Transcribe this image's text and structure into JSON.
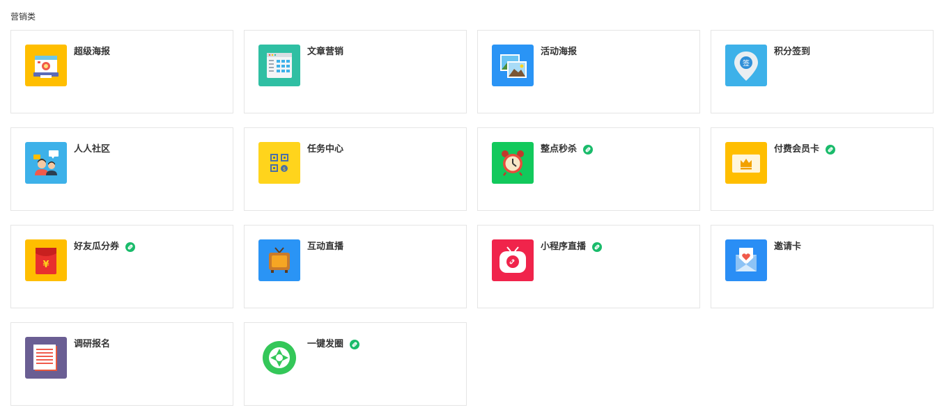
{
  "section": {
    "title": "营销类"
  },
  "cards": [
    {
      "title": "超级海报",
      "icon": "poster-camera-icon",
      "bg": "#FFBE00",
      "mini_program": false
    },
    {
      "title": "文章营销",
      "icon": "article-webpage-icon",
      "bg": "#2FBFA3",
      "mini_program": false
    },
    {
      "title": "活动海报",
      "icon": "picture-frames-icon",
      "bg": "#2A94F5",
      "mini_program": false
    },
    {
      "title": "积分签到",
      "icon": "sign-in-pin-icon",
      "bg": "#3DB1E9",
      "mini_program": false
    },
    {
      "title": "人人社区",
      "icon": "community-people-icon",
      "bg": "#3DB1E9",
      "mini_program": false
    },
    {
      "title": "任务中心",
      "icon": "task-qrcode-icon",
      "bg": "#FFD41C",
      "mini_program": false
    },
    {
      "title": "整点秒杀",
      "icon": "alarm-clock-icon",
      "bg": "#12C95C",
      "mini_program": true
    },
    {
      "title": "付费会员卡",
      "icon": "crown-card-icon",
      "bg": "#FFBE00",
      "mini_program": true
    },
    {
      "title": "好友瓜分券",
      "icon": "red-envelope-icon",
      "bg": "#FFBE00",
      "mini_program": true
    },
    {
      "title": "互动直播",
      "icon": "retro-tv-icon",
      "bg": "#2A94F5",
      "mini_program": false
    },
    {
      "title": "小程序直播",
      "icon": "live-tv-icon",
      "bg": "#F0244B",
      "mini_program": true
    },
    {
      "title": "邀请卡",
      "icon": "heart-envelope-icon",
      "bg": "#2A8EF5",
      "mini_program": false
    },
    {
      "title": "调研报名",
      "icon": "survey-notebook-icon",
      "bg": "#6A5E93",
      "mini_program": false
    },
    {
      "title": "一键发圈",
      "icon": "moments-shutter-icon",
      "bg": "#ffffff",
      "mini_program": true
    }
  ],
  "mini_program_badge": {
    "icon": "mini-program-link-icon",
    "color": "#1ABB6B"
  }
}
